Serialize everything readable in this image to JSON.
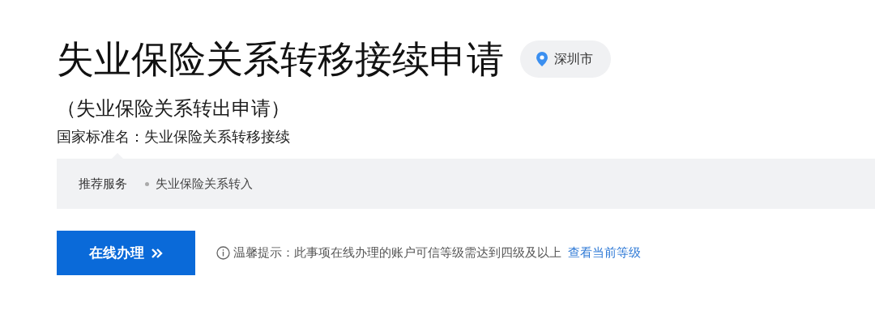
{
  "title": "失业保险关系转移接续申请",
  "location": {
    "label": "深圳市"
  },
  "subtitle": "（失业保险关系转出申请）",
  "standard_name": "国家标准名：失业保险关系转移接续",
  "recommended": {
    "label": "推荐服务",
    "items": [
      "失业保险关系转入"
    ]
  },
  "apply_button": {
    "label": "在线办理"
  },
  "tip": {
    "text": "温馨提示：此事项在线办理的账户可信等级需达到四级及以上",
    "link": "查看当前等级"
  }
}
